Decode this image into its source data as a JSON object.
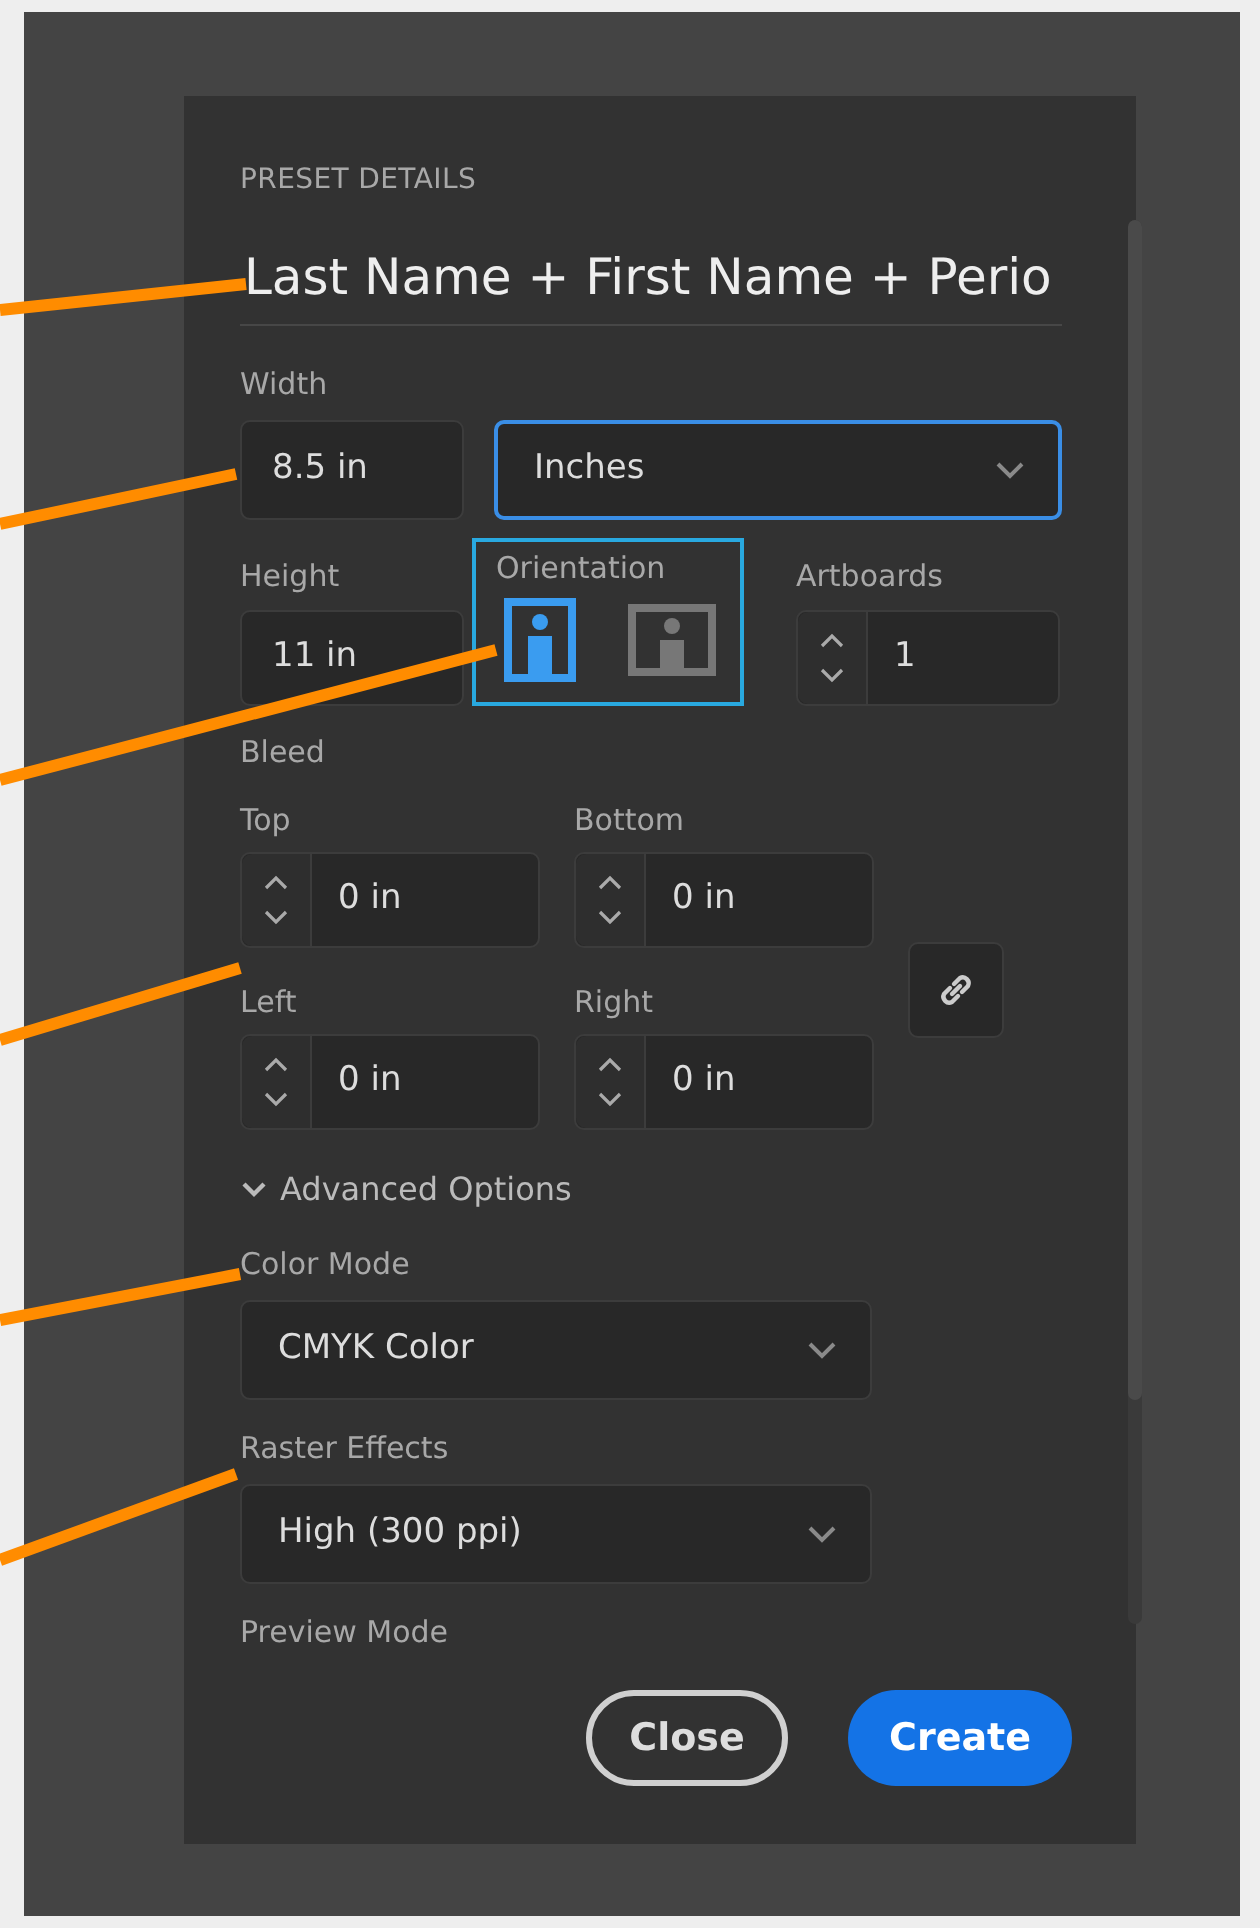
{
  "section_title": "PRESET DETAILS",
  "preset_name": {
    "value": "Last Name + First Name + Perio"
  },
  "width": {
    "label": "Width",
    "value": "8.5 in"
  },
  "units": {
    "value": "Inches",
    "focused": true
  },
  "height": {
    "label": "Height",
    "value": "11 in"
  },
  "orientation": {
    "label": "Orientation",
    "options": [
      {
        "kind": "portrait",
        "selected": true
      },
      {
        "kind": "landscape",
        "selected": false
      }
    ]
  },
  "artboards": {
    "label": "Artboards",
    "value": "1"
  },
  "bleed": {
    "label": "Bleed",
    "fields": [
      {
        "label": "Top",
        "value": "0 in"
      },
      {
        "label": "Bottom",
        "value": "0 in"
      },
      {
        "label": "Left",
        "value": "0 in"
      },
      {
        "label": "Right",
        "value": "0 in"
      }
    ]
  },
  "advanced": {
    "label": "Advanced Options",
    "expanded": true
  },
  "color_mode": {
    "label": "Color Mode",
    "value": "CMYK Color"
  },
  "raster_effects": {
    "label": "Raster Effects",
    "value": "High (300 ppi)"
  },
  "preview_mode": {
    "label": "Preview Mode"
  },
  "buttons": [
    {
      "label": "Close",
      "kind": "secondary"
    },
    {
      "label": "Create",
      "kind": "primary"
    }
  ]
}
